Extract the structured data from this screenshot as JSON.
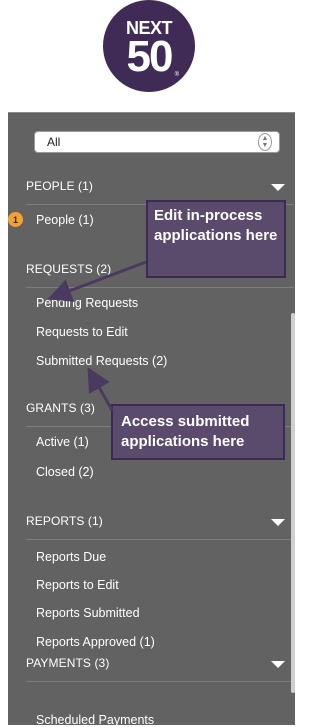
{
  "logo": {
    "top": "NEXT",
    "big": "50",
    "reg": "®"
  },
  "filter": {
    "selected": "All"
  },
  "sections": [
    {
      "id": "people",
      "header": "PEOPLE (1)",
      "items": [
        {
          "label": "People  (1)",
          "badge": "1"
        }
      ]
    },
    {
      "id": "requests",
      "header": "REQUESTS (2)",
      "items": [
        {
          "label": "Pending Requests"
        },
        {
          "label": "Requests to Edit"
        },
        {
          "label": "Submitted Requests  (2)"
        }
      ]
    },
    {
      "id": "grants",
      "header": "GRANTS (3)",
      "items": [
        {
          "label": "Active  (1)"
        },
        {
          "label": "Closed  (2)"
        }
      ]
    },
    {
      "id": "reports",
      "header": "REPORTS (1)",
      "items": [
        {
          "label": "Reports Due"
        },
        {
          "label": "Reports to Edit"
        },
        {
          "label": "Reports Submitted"
        },
        {
          "label": "Reports Approved  (1)"
        }
      ]
    },
    {
      "id": "payments",
      "header": "PAYMENTS (3)",
      "items": [
        {
          "label": "Scheduled Payments"
        }
      ]
    }
  ],
  "callouts": {
    "edit": "Edit in-process applications here",
    "access": "Access submitted applications here"
  },
  "colors": {
    "panel": "#626262",
    "callout": "#5a4a6c",
    "callout_border": "#3b2a52",
    "badge": "#f0a23a",
    "logo": "#3f2b55"
  }
}
